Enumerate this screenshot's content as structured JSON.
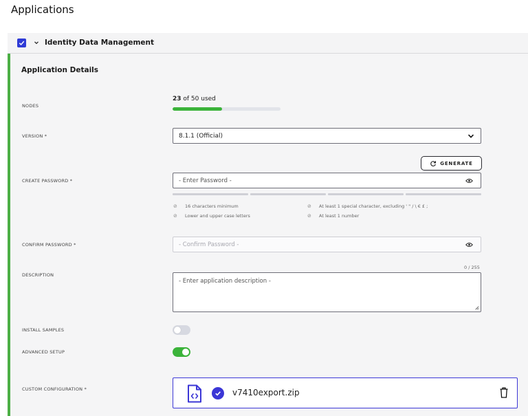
{
  "page": {
    "title": "Applications"
  },
  "group": {
    "title": "Identity Data Management",
    "checked": true
  },
  "details": {
    "title": "Application Details",
    "nodes": {
      "label": "NODES",
      "used": "23",
      "suffix": " of 50 used",
      "fraction": 0.46
    },
    "version": {
      "label": "VERSION *",
      "value": "8.1.1 (Official)"
    },
    "generate": {
      "label": "GENERATE"
    },
    "create_password": {
      "label": "CREATE PASSWORD *",
      "placeholder": "- Enter Password -"
    },
    "rules": [
      "16 characters minimum",
      "At least 1 special character, excluding ' \" / \\ € £ ;",
      "Lower and upper case letters",
      "At least 1 number"
    ],
    "confirm_password": {
      "label": "CONFIRM PASSWORD *",
      "placeholder": "- Confirm Password -"
    },
    "description": {
      "label": "DESCRIPTION",
      "placeholder": "- Enter application description -",
      "counter": "0 / 255"
    },
    "install_samples": {
      "label": "INSTALL SAMPLES",
      "on": false
    },
    "advanced_setup": {
      "label": "ADVANCED SETUP",
      "on": true
    },
    "custom_config": {
      "label": "CUSTOM CONFIGURATION *",
      "file_name": "v7410export.zip"
    }
  },
  "colors": {
    "accent": "#3b36d6",
    "success": "#3bb33a",
    "checkbox": "#2f3bd6"
  }
}
